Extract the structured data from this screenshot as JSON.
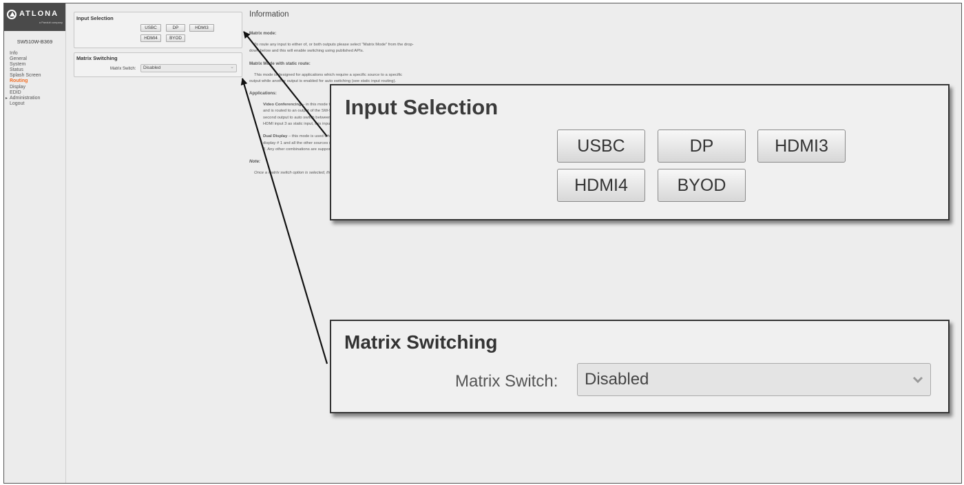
{
  "sidebar": {
    "logo_text": "ATLONA",
    "logo_sub": "a Panduit company",
    "device_name": "SW510W-B369",
    "items": [
      {
        "label": "Info",
        "active": false
      },
      {
        "label": "General",
        "active": false
      },
      {
        "label": "System",
        "active": false
      },
      {
        "label": "Status",
        "active": false
      },
      {
        "label": "Splash Screen",
        "active": false
      },
      {
        "label": "Routing",
        "active": true
      },
      {
        "label": "Display",
        "active": false
      },
      {
        "label": "EDID",
        "active": false
      },
      {
        "label": "Administration",
        "active": false,
        "caret": "▸"
      },
      {
        "label": "Logout",
        "active": false
      }
    ]
  },
  "input_selection": {
    "title": "Input Selection",
    "buttons": [
      "USBC",
      "DP",
      "HDMI3",
      "HDMI4",
      "BYOD"
    ]
  },
  "matrix_switching": {
    "title": "Matrix Switching",
    "label": "Matrix Switch:",
    "value": "Disabled"
  },
  "info": {
    "title": "Information",
    "matrix_mode_h": "Matrix mode:",
    "matrix_mode_p": "To route any input to either of, or both outputs please select \"Matrix Mode\" from the drop-down below and this will enable switching using published APIs.",
    "static_h": "Matrix Mode with static route:",
    "static_p": "This mode is designed for applications which require a specific source to a specific output while another output is enabled for auto switching (see static input routing).",
    "apps_h": "Applications:",
    "app_a_bold": "Video Conferencing",
    "app_a_text": " – in this mode the camera is connected to one of the inputs and is routed to an output of the SW-510 (static route). This mode will allow the second output to auto switch between the inputs, including BYOD. For example, use HDMI input 3 as static input, this input is excluded from auto switching.",
    "app_b_bold": "Dual Display",
    "app_b_text": " – this mode is used when you may want to have a specific source on display # 1 and all the other sources (HDMI, DisplayPort and USB-C) on Display # 2. Any other combinations are supported.",
    "note_h": "Note:",
    "note_p": "Once a matrix switch option is selected, the display control will no longer work."
  },
  "colors": {
    "accent": "#f26c22",
    "logo_bar": "#4a4a4a"
  }
}
